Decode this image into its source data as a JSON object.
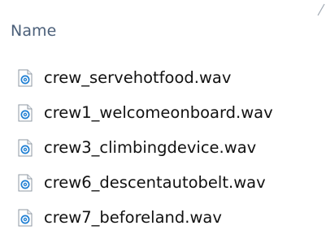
{
  "details_view": {
    "column_header": "Name",
    "files": [
      {
        "name": "crew_servehotfood.wav",
        "icon": "audio-file-icon"
      },
      {
        "name": "crew1_welcomeonboard.wav",
        "icon": "audio-file-icon"
      },
      {
        "name": "crew3_climbingdevice.wav",
        "icon": "audio-file-icon"
      },
      {
        "name": "crew6_descentautobelt.wav",
        "icon": "audio-file-icon"
      },
      {
        "name": "crew7_beforeland.wav",
        "icon": "audio-file-icon"
      }
    ]
  },
  "colors": {
    "header_text": "#4c607a",
    "file_text": "#111111",
    "icon_blue": "#1f7fd3"
  }
}
